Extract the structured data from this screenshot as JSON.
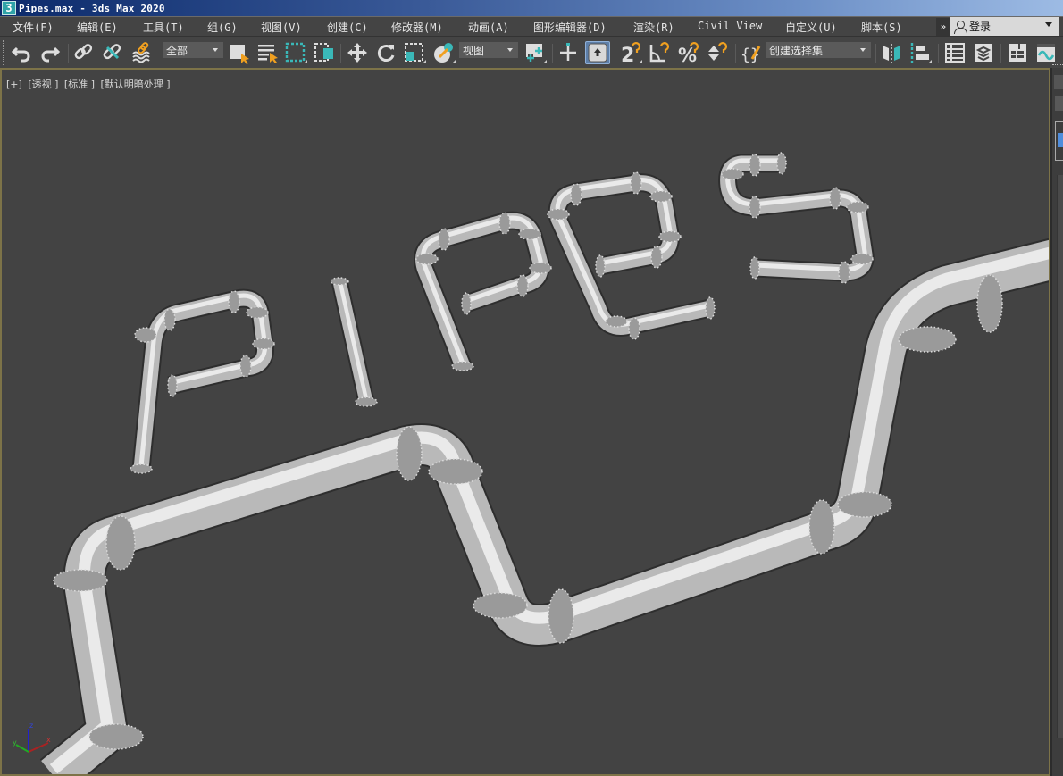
{
  "window": {
    "app_icon_glyph": "3",
    "title": "Pipes.max - 3ds Max 2020"
  },
  "menu": {
    "items": [
      {
        "label": "文件(F)"
      },
      {
        "label": "编辑(E)"
      },
      {
        "label": "工具(T)"
      },
      {
        "label": "组(G)"
      },
      {
        "label": "视图(V)"
      },
      {
        "label": "创建(C)"
      },
      {
        "label": "修改器(M)"
      },
      {
        "label": "动画(A)"
      },
      {
        "label": "图形编辑器(D)"
      },
      {
        "label": "渲染(R)"
      },
      {
        "label": "Civil View"
      },
      {
        "label": "自定义(U)"
      },
      {
        "label": "脚本(S)"
      }
    ],
    "overflow_glyph": "»",
    "login_label": "登录"
  },
  "toolbar": {
    "icons": [
      "undo-icon",
      "redo-icon",
      "select-and-link-icon",
      "unlink-selection-icon",
      "bind-to-space-warp-icon",
      "select-object-icon",
      "select-by-name-icon",
      "rectangular-selection-region-icon",
      "window-crossing-icon",
      "select-and-move-icon",
      "select-and-rotate-icon",
      "select-and-scale-icon",
      "select-and-place-icon",
      "use-pivot-point-center-icon",
      "select-and-manipulate-icon",
      "keyboard-shortcut-override-icon",
      "snaps-toggle-icon",
      "angle-snap-toggle-icon",
      "percent-snap-toggle-icon",
      "spinner-snap-toggle-icon",
      "edit-named-selection-sets-icon",
      "mirror-icon",
      "align-icon",
      "toggle-scene-explorer-icon",
      "toggle-layer-explorer-icon",
      "toggle-ribbon-icon",
      "curve-editor-icon"
    ],
    "selection_filter": "全部",
    "reference_coord_system": "视图",
    "named_selection_set": "创建选择集",
    "snaps_value": "2"
  },
  "viewport": {
    "labels": [
      "[+]",
      "[透视 ]",
      "[标准 ]",
      "[默认明暗处理 ]"
    ],
    "scene_text": "PIPES",
    "axes": {
      "x": "x",
      "y": "y",
      "z": "z"
    }
  },
  "colors": {
    "viewport_bg": "#434343",
    "viewport_border": "#7d7348",
    "accent_teal": "#3ab8b8",
    "accent_orange": "#f0a020",
    "active_button": "#5e7fa8"
  }
}
